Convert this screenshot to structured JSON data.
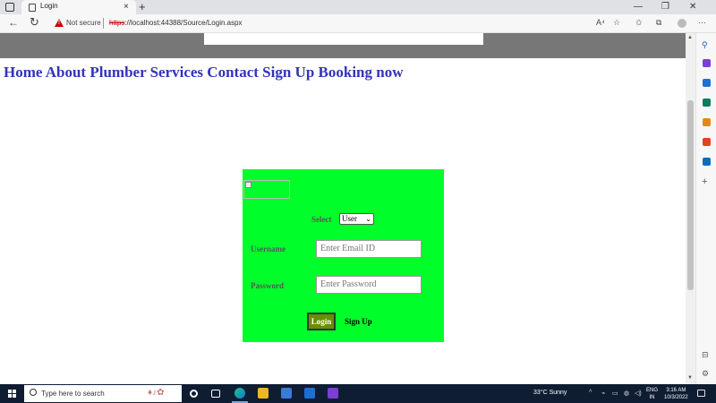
{
  "browser": {
    "tab_title": "Login",
    "tab_close": "×",
    "new_tab": "+",
    "window_minimize": "—",
    "window_maximize": "❐",
    "window_close": "✕",
    "back_glyph": "←",
    "refresh_glyph": "↻",
    "security_label": "Not secure",
    "url_scheme": "https",
    "url_rest": "://localhost:44388/Source/Login.aspx",
    "read_aloud": "A⁴",
    "more": "···"
  },
  "nav": {
    "home": "Home",
    "about": "About",
    "services": "Plumber Services",
    "contact": "Contact",
    "signup": "Sign Up",
    "booking": "Booking now"
  },
  "login": {
    "select_label": "Select",
    "role_selected": "User",
    "username_label": "Username",
    "username_placeholder": "Enter Email ID",
    "password_label": "Password",
    "password_placeholder": "Enter Password",
    "login_button": "Login",
    "signup_link": "Sign Up"
  },
  "taskbar": {
    "search_placeholder": "Type here to search",
    "weather": "33°C  Sunny",
    "lang_top": "ENG",
    "lang_bottom": "IN",
    "time": "3:16 AM",
    "date": "10/3/2022"
  },
  "colors": {
    "panel_bg": "#00ff2a",
    "nav_text": "#3333bb",
    "header_band": "#777777",
    "login_button_bg": "#6b8e00"
  }
}
